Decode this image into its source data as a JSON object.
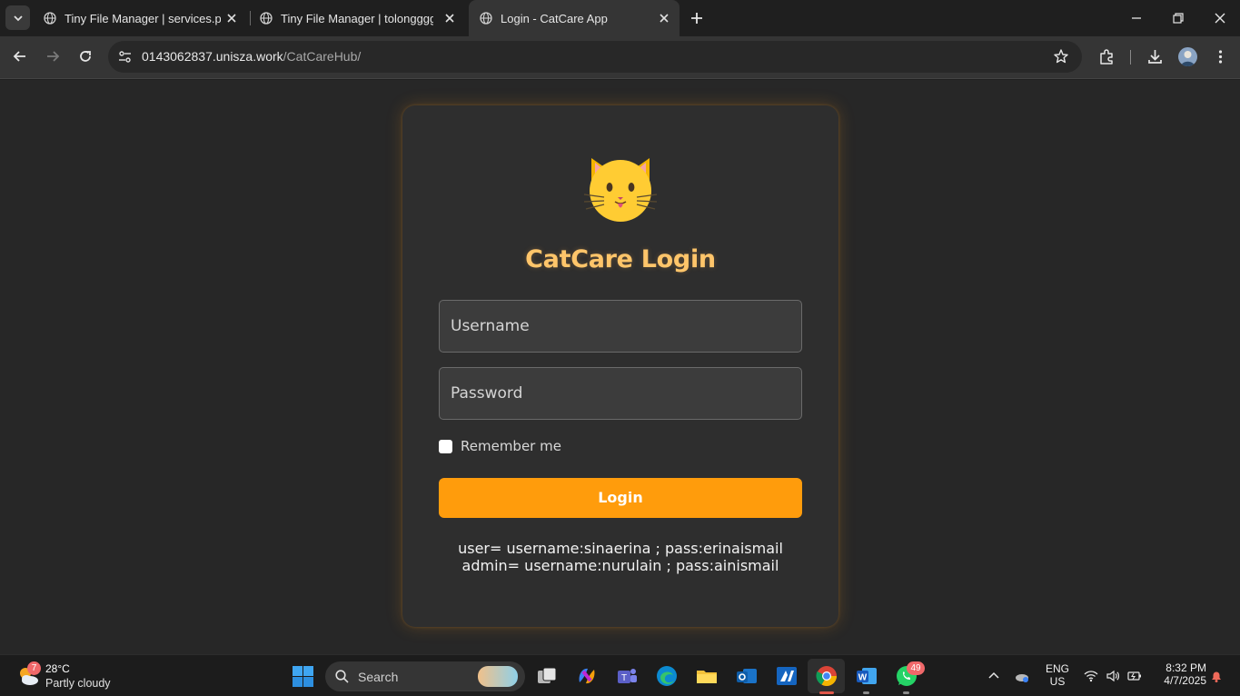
{
  "browser": {
    "tabs": [
      {
        "title": "Tiny File Manager | services.php",
        "active": false
      },
      {
        "title": "Tiny File Manager | tolonggggg.php",
        "active": false
      },
      {
        "title": "Login - CatCare App",
        "active": true
      }
    ],
    "url_host": "0143062837.unisza.work",
    "url_path": "/CatCareHub/"
  },
  "page": {
    "heading": "CatCare Login",
    "username_placeholder": "Username",
    "password_placeholder": "Password",
    "remember_label": "Remember me",
    "login_button": "Login",
    "credentials_user": "user= username:sinaerina ; pass:erinaismail",
    "credentials_admin": "admin= username:nurulain ; pass:ainismail",
    "accent_color": "#ff9c0c",
    "heading_color": "#ffc56a"
  },
  "taskbar": {
    "weather_badge": "7",
    "temperature": "28°C",
    "weather_desc": "Partly cloudy",
    "search_label": "Search",
    "whatsapp_badge": "49",
    "language_line1": "ENG",
    "language_line2": "US",
    "time": "8:32 PM",
    "date": "4/7/2025"
  }
}
